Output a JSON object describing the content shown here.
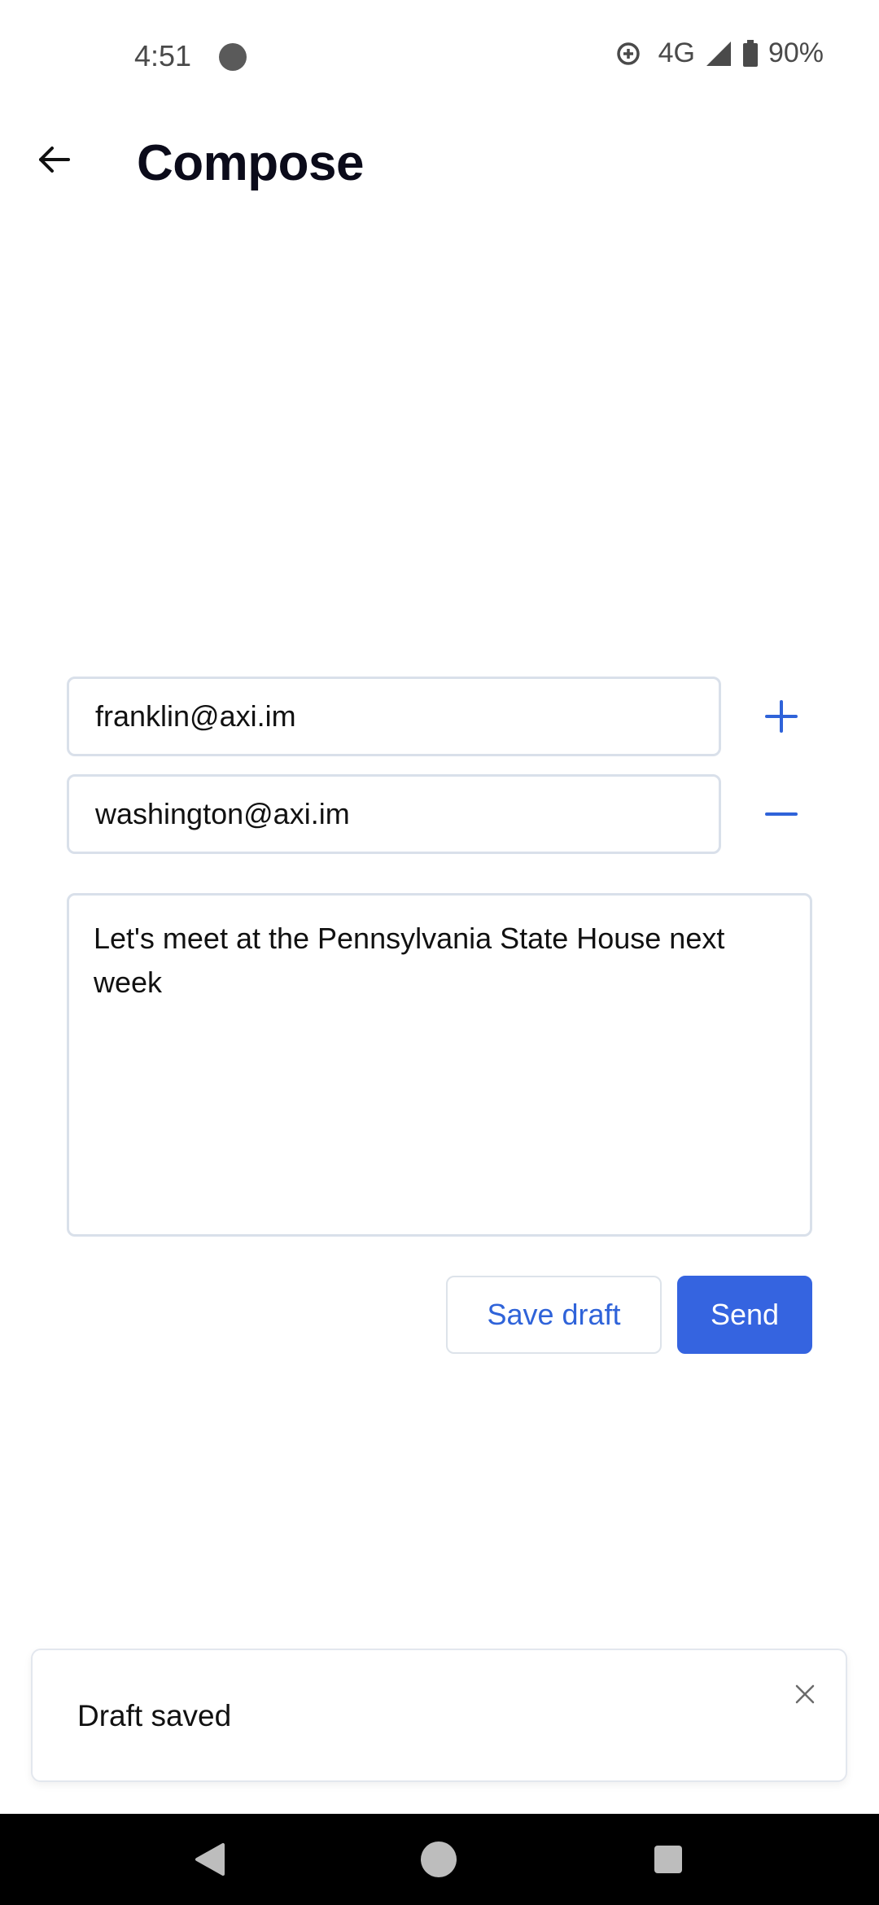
{
  "status_bar": {
    "time": "4:51",
    "network": "4G",
    "battery": "90%",
    "icons": [
      "notification-dot-icon",
      "data-saver-icon",
      "signal-icon",
      "battery-icon"
    ]
  },
  "header": {
    "title": "Compose",
    "back_icon": "arrow-left-icon"
  },
  "recipients": [
    {
      "value": "franklin@axi.im",
      "action_icon": "plus-icon"
    },
    {
      "value": "washington@axi.im",
      "action_icon": "minus-icon"
    }
  ],
  "message": {
    "body": "Let's meet at the Pennsylvania State House next week"
  },
  "actions": {
    "save_draft_label": "Save draft",
    "send_label": "Send"
  },
  "toast": {
    "text": "Draft saved",
    "close_icon": "close-icon"
  },
  "nav_bar": {
    "icons": [
      "nav-back-icon",
      "nav-home-icon",
      "nav-recents-icon"
    ]
  },
  "colors": {
    "accent": "#3564e0",
    "accent_text": "#2f63d9",
    "border": "#d9e0ea",
    "nav_bar": "#000000"
  }
}
